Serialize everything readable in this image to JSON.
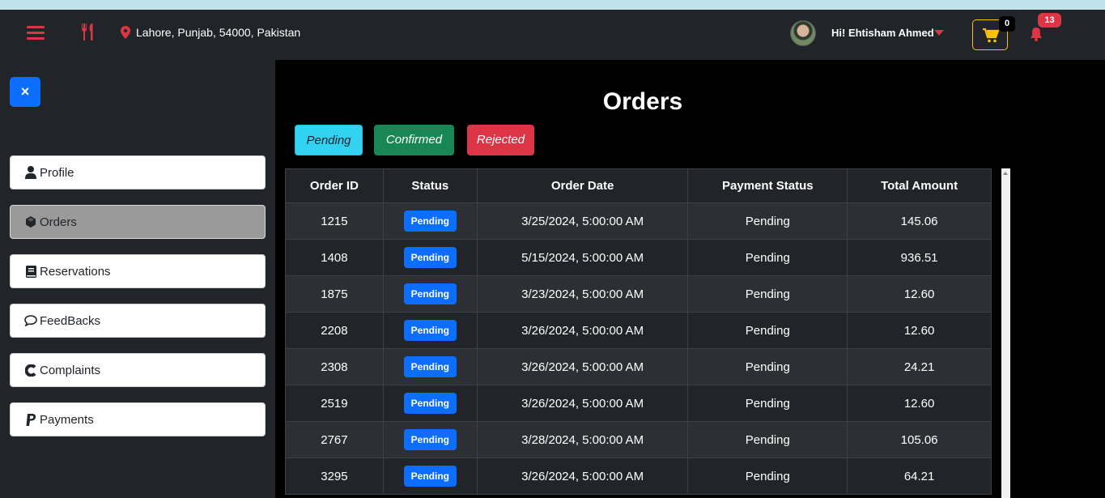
{
  "header": {
    "location": "Lahore, Punjab, 54000, Pakistan",
    "greeting": "Hi! Ehtisham Ahmed",
    "cart_count": "0",
    "notification_count": "13",
    "icons": [
      "hamburger-menu-icon",
      "utensils-icon",
      "map-pin-icon",
      "avatar",
      "caret-down-icon",
      "cart-icon",
      "bell-icon"
    ],
    "accent_color": "#dc3545"
  },
  "sidebar": {
    "close_label": "×",
    "items": [
      {
        "label": "Profile",
        "icon": "user-icon"
      },
      {
        "label": "Orders",
        "icon": "box-icon",
        "active": true
      },
      {
        "label": "Reservations",
        "icon": "book-icon"
      },
      {
        "label": "FeedBacks",
        "icon": "comment-icon"
      },
      {
        "label": "Complaints",
        "icon": "complaint-icon"
      },
      {
        "label": "Payments",
        "icon": "paypal-icon"
      }
    ]
  },
  "main": {
    "title": "Orders",
    "filters": [
      {
        "label": "Pending",
        "color": "#31d2f2"
      },
      {
        "label": "Confirmed",
        "color": "#198754"
      },
      {
        "label": "Rejected",
        "color": "#dc3545"
      }
    ],
    "table": {
      "headers": [
        "Order ID",
        "Status",
        "Order Date",
        "Payment Status",
        "Total Amount"
      ],
      "rows": [
        [
          "1215",
          "Pending",
          "3/25/2024, 5:00:00 AM",
          "Pending",
          "145.06"
        ],
        [
          "1408",
          "Pending",
          "5/15/2024, 5:00:00 AM",
          "Pending",
          "936.51"
        ],
        [
          "1875",
          "Pending",
          "3/23/2024, 5:00:00 AM",
          "Pending",
          "12.60"
        ],
        [
          "2208",
          "Pending",
          "3/26/2024, 5:00:00 AM",
          "Pending",
          "12.60"
        ],
        [
          "2308",
          "Pending",
          "3/26/2024, 5:00:00 AM",
          "Pending",
          "24.21"
        ],
        [
          "2519",
          "Pending",
          "3/26/2024, 5:00:00 AM",
          "Pending",
          "12.60"
        ],
        [
          "2767",
          "Pending",
          "3/28/2024, 5:00:00 AM",
          "Pending",
          "105.06"
        ],
        [
          "3295",
          "Pending",
          "3/26/2024, 5:00:00 AM",
          "Pending",
          "64.21"
        ]
      ]
    }
  }
}
